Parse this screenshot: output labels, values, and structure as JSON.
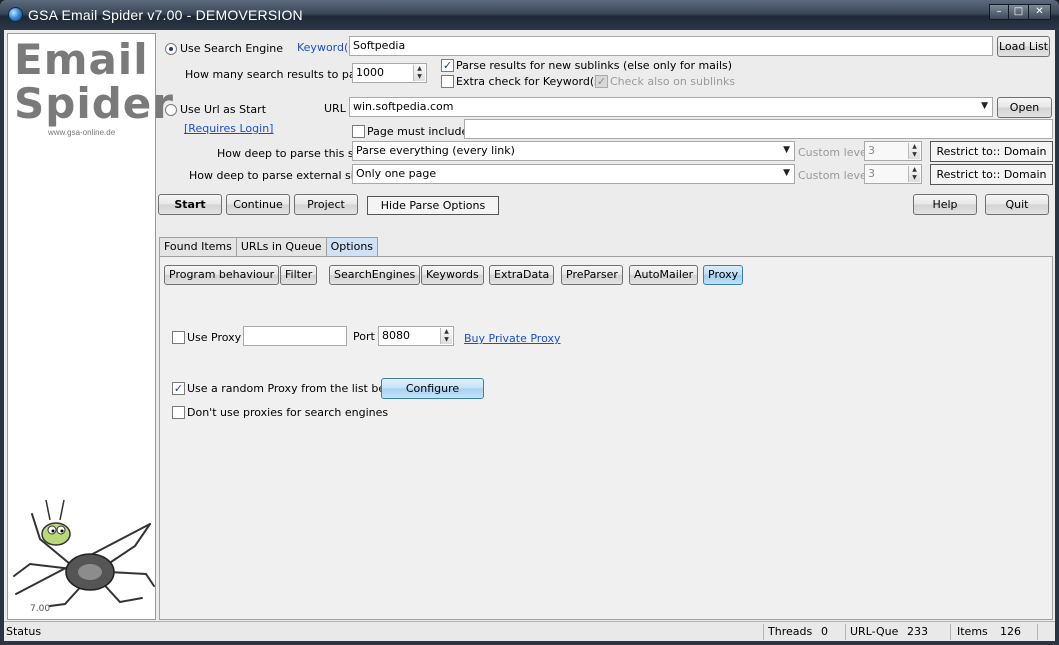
{
  "window": {
    "title": "GSA Email Spider v7.00 - DEMOVERSION",
    "controls": [
      "minimize",
      "maximize",
      "close"
    ]
  },
  "logo": {
    "line1": "Email",
    "line2": "Spider",
    "site": "www.gsa-online.de",
    "version": "7.00"
  },
  "search": {
    "use_search_engine_label": "Use Search Engine",
    "keywords_label": "Keyword(s)",
    "keywords_value": "Softpedia",
    "load_list_label": "Load List",
    "results_label": "How many search results to parse",
    "results_value": "1000",
    "parse_sublinks_label": "Parse results for new sublinks (else only for mails)",
    "parse_sublinks_checked": true,
    "extra_check_label": "Extra check for Keyword(s)",
    "extra_check_checked": false,
    "check_sublinks_label": "Check also on sublinks",
    "check_sublinks_checked": true
  },
  "url": {
    "use_url_label": "Use Url as Start",
    "url_label": "URL",
    "url_value": "win.softpedia.com",
    "open_label": "Open",
    "requires_login_label": "[Requires Login]",
    "page_must_include_label": "Page must include",
    "page_must_include_value": "",
    "depth_site_label": "How deep to parse this site",
    "depth_site_value": "Parse everything (every link)",
    "depth_external_label": "How deep to parse external sites",
    "depth_external_value": "Only one page",
    "custom_level_label": "Custom level",
    "custom_level_site_value": "3",
    "custom_level_ext_value": "3",
    "restrict_label": "Restrict to:: Domain"
  },
  "toolbar": {
    "start": "Start",
    "continue": "Continue",
    "project": "Project",
    "hide_parse_options": "Hide Parse Options",
    "help": "Help",
    "quit": "Quit"
  },
  "tabs": [
    "Found Items",
    "URLs in Queue",
    "Options"
  ],
  "active_tab": "Options",
  "subtabs": [
    "Program behaviour",
    "Filter",
    "SearchEngines",
    "Keywords",
    "ExtraData",
    "PreParser",
    "AutoMailer",
    "Proxy"
  ],
  "active_subtab": "Proxy",
  "proxy": {
    "use_proxy_label": "Use Proxy",
    "use_proxy_checked": false,
    "proxy_value": "",
    "port_label": "Port",
    "port_value": "8080",
    "buy_label": "Buy Private Proxy",
    "random_proxy_label": "Use a random Proxy from the list below",
    "random_proxy_checked": true,
    "configure_label": "Configure",
    "no_proxy_search_label": "Don't use proxies for search engines",
    "no_proxy_search_checked": false
  },
  "status": {
    "status_label": "Status",
    "threads_label": "Threads",
    "threads_value": "0",
    "urlque_label": "URL-Que",
    "urlque_value": "233",
    "items_label": "Items",
    "items_value": "126"
  },
  "colors": {
    "link": "#1a4fd0",
    "active_tab": "#cfe2f5",
    "titlebar": "#2b3846"
  }
}
